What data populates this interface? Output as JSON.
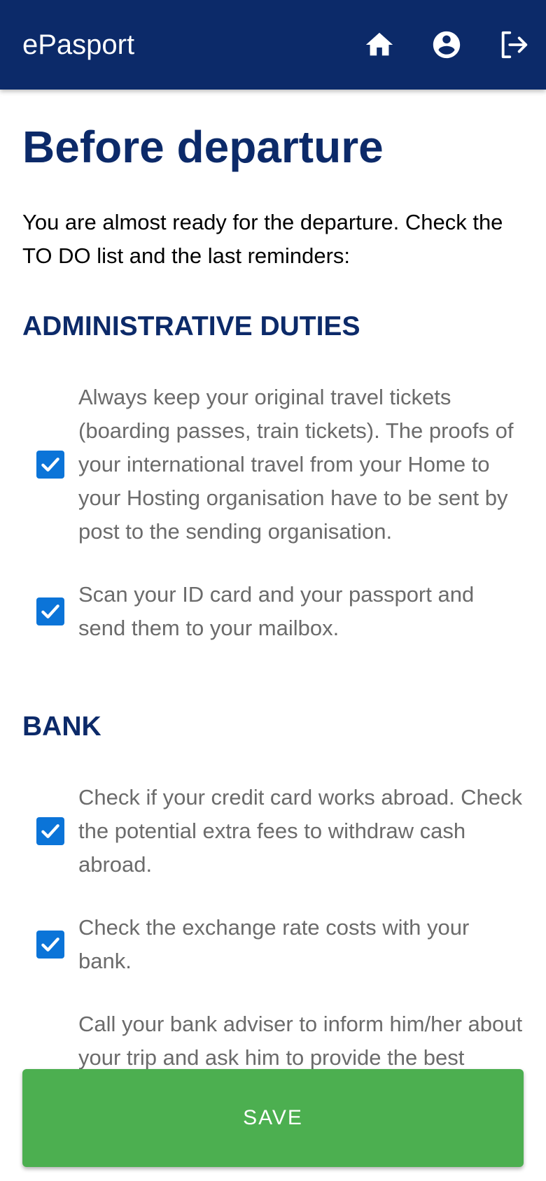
{
  "appbar": {
    "title": "ePasport",
    "icons": [
      "home-icon",
      "account-circle-icon",
      "logout-icon"
    ]
  },
  "page": {
    "title": "Before departure",
    "intro": "You are almost ready for the departure. Check the TO DO list and the last reminders:"
  },
  "sections": [
    {
      "title": "ADMINISTRATIVE DUTIES",
      "items": [
        {
          "text": "Always keep your original travel tickets (boarding passes, train tickets). The proofs of your international travel from your Home to your Hosting organisation have to be sent by post to the sending organisation.",
          "checked": true
        },
        {
          "text": "Scan your ID card and your passport and send them to your mailbox.",
          "checked": true
        }
      ]
    },
    {
      "title": "BANK",
      "items": [
        {
          "text": "Check if your credit card works abroad. Check the potential extra fees to withdraw cash abroad.",
          "checked": true
        },
        {
          "text": "Check the exchange rate costs with your bank.",
          "checked": true
        },
        {
          "text": "Call your bank adviser to inform him/her about your trip and ask him to provide the best possible solutions for you, in order to reduce the extra fees.",
          "checked": false
        }
      ]
    }
  ],
  "footer": {
    "save_label": "SAVE"
  },
  "colors": {
    "appbar": "#0c2a69",
    "accent": "#0b74d8",
    "save": "#4caf50"
  }
}
